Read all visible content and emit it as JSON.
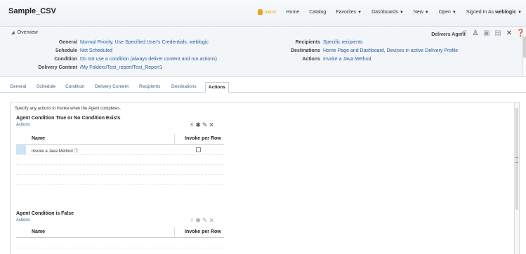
{
  "header": {
    "title": "Sample_CSV",
    "alerts_label": "Alerts!",
    "nav": [
      {
        "label": "Home",
        "caret": false
      },
      {
        "label": "Catalog",
        "caret": false
      },
      {
        "label": "Favorites",
        "caret": true
      },
      {
        "label": "Dashboards",
        "caret": true
      },
      {
        "label": "New",
        "caret": true
      },
      {
        "label": "Open",
        "caret": true
      }
    ],
    "signed_in_label": "Signed In As",
    "user": "weblogic"
  },
  "overview": {
    "title": "Overview",
    "delivers_label": "Delivers Agent",
    "left": [
      {
        "label": "General",
        "value": "Normal Priority, Use Specified User's Credentials: weblogic"
      },
      {
        "label": "Schedule",
        "value": "Not Scheduled"
      },
      {
        "label": "Condition",
        "value": "Do not use a condition (always deliver content and run actions)"
      },
      {
        "label": "Delivery Content",
        "value": "/My Folders/Test_report/Test_Report1"
      }
    ],
    "right": [
      {
        "label": "Recipients",
        "value": "Specific recipients"
      },
      {
        "label": "Destinations",
        "value": "Home Page and Dashboard, Devices in active Delivery Profile"
      },
      {
        "label": "Actions",
        "value": "Invoke a Java Method"
      }
    ]
  },
  "tabs": [
    "General",
    "Schedule",
    "Condition",
    "Delivery Content",
    "Recipients",
    "Destinations",
    "Actions"
  ],
  "active_tab": "Actions",
  "content": {
    "instructions": "Specify any actions to invoke when the Agent completes.",
    "section_true": {
      "title": "Agent Condition True or No Condition Exists",
      "subtitle": "Actions",
      "col_name": "Name",
      "col_invoke": "Invoke per Row",
      "rows": [
        {
          "name": "Invoke a Java Method",
          "invoke_per_row": false
        }
      ]
    },
    "section_false": {
      "title": "Agent Condition is False",
      "subtitle": "Actions",
      "col_name": "Name",
      "col_invoke": "Invoke per Row"
    }
  }
}
